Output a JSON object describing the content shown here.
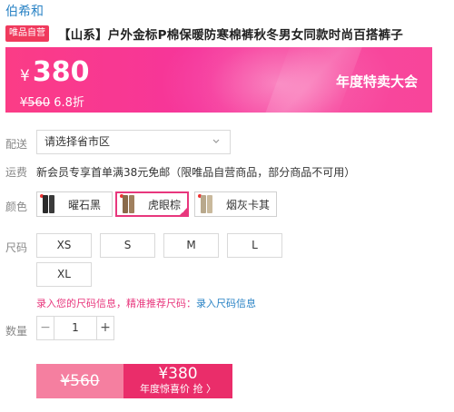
{
  "brand": "伯希和",
  "product": {
    "badge": "唯品自营",
    "title": "【山系】户外金标P棉保暖防寒棉裤秋冬男女同款时尚百搭裤子"
  },
  "price_banner": {
    "currency": "¥",
    "current_price": "380",
    "original_price": "¥560",
    "discount": "6.8折",
    "event_text": "年度特卖大会",
    "colors": {
      "start": "#fb3c86",
      "end": "#f8459a"
    }
  },
  "delivery": {
    "label": "配送",
    "select_value": "请选择省市区"
  },
  "shipping": {
    "label": "运费",
    "text": "新会员专享首单满38元免邮（限唯品自营商品，部分商品不可用）"
  },
  "color_section": {
    "label": "颜色",
    "options": [
      {
        "name": "曜石黑",
        "selected": false,
        "swatch": "#2b2b2b"
      },
      {
        "name": "虎眼棕",
        "selected": true,
        "swatch": "#8a6a4a"
      },
      {
        "name": "烟灰卡其",
        "selected": false,
        "swatch": "#b8a88c"
      }
    ]
  },
  "size_section": {
    "label": "尺码",
    "options": [
      "XS",
      "S",
      "M",
      "L",
      "XL"
    ]
  },
  "size_tip": {
    "text": "录入您的尺码信息，精准推荐尺码：",
    "link": "录入尺码信息"
  },
  "quantity": {
    "label": "数量",
    "minus": "−",
    "value": "1",
    "plus": "+"
  },
  "buy_bar": {
    "original_price": "¥560",
    "sale_price": "¥380",
    "sale_text": "年度惊喜价 抢 〉",
    "colors": {
      "left": "#f57fa0",
      "right": "#ea2d6a"
    }
  }
}
